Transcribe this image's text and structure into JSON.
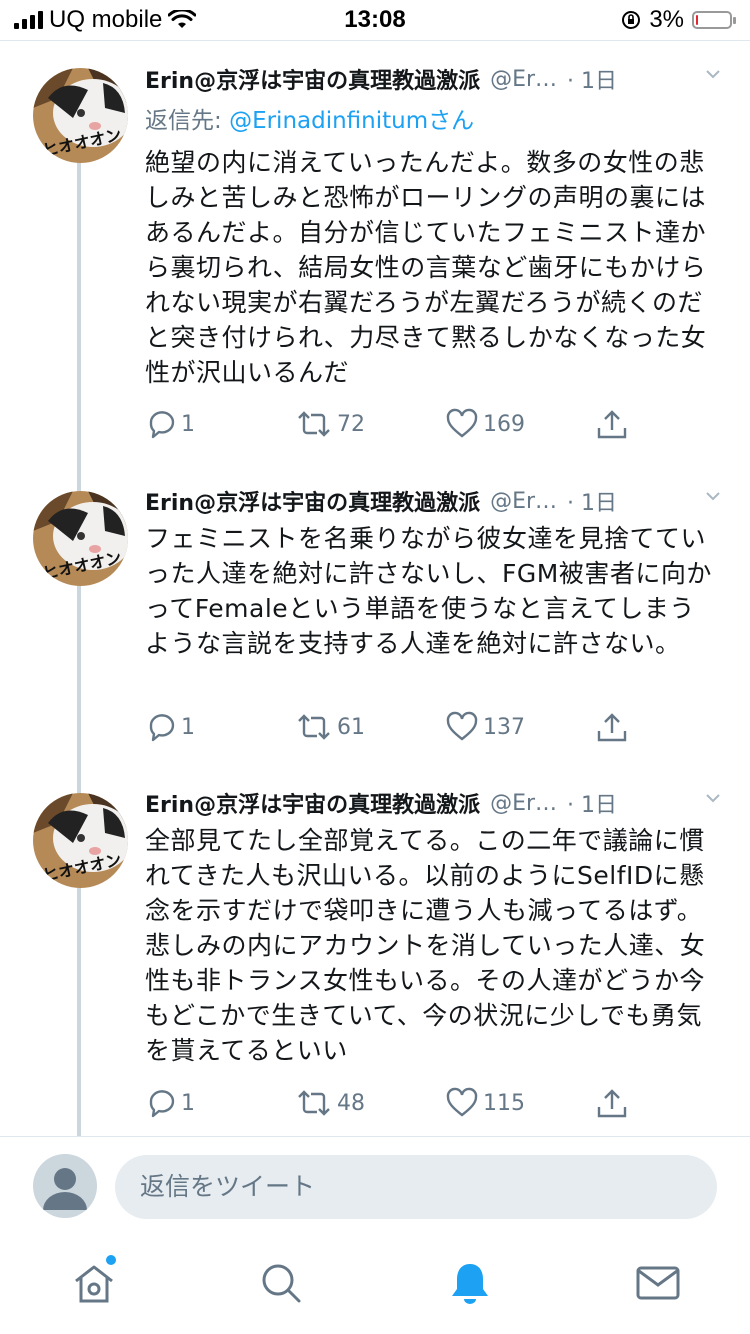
{
  "status_bar": {
    "carrier": "UQ mobile",
    "time": "13:08",
    "battery_percent_text": "3%",
    "battery_level": 0.03
  },
  "tweets": [
    {
      "author_name": "Erin@京浮は宇宙の真理教過激派",
      "handle": "@Er…",
      "time": "· 1日",
      "reply_to_prefix": "返信先: ",
      "reply_to_handle": "@Erinadinfinitum",
      "reply_to_suffix": "さん",
      "text": "絶望の内に消えていったんだよ。数多の女性の悲しみと苦しみと恐怖がローリングの声明の裏にはあるんだよ。自分が信じていたフェミニスト達から裏切られ、結局女性の言葉など歯牙にもかけられない現実が右翼だろうが左翼だろうが続くのだと突き付けられ、力尽きて黙るしかなくなった女性が沢山いるんだ",
      "replies": "1",
      "retweets": "72",
      "likes": "169"
    },
    {
      "author_name": "Erin@京浮は宇宙の真理教過激派",
      "handle": "@Er…",
      "time": "· 1日",
      "text": "フェミニストを名乗りながら彼女達を見捨てていった人達を絶対に許さないし、FGM被害者に向かってFemaleという単語を使うなと言えてしまうような言説を支持する人達を絶対に許さない。",
      "replies": "1",
      "retweets": "61",
      "likes": "137"
    },
    {
      "author_name": "Erin@京浮は宇宙の真理教過激派",
      "handle": "@Er…",
      "time": "· 1日",
      "text": "全部見てたし全部覚えてる。この二年で議論に慣れてきた人も沢山いる。以前のようにSelfIDに懸念を示すだけで袋叩きに遭う人も減ってるはず。悲しみの内にアカウントを消していった人達、女性も非トランス女性もいる。その人達がどうか今もどこかで生きていて、今の状況に少しでも勇気を貰えてるといい",
      "replies": "1",
      "retweets": "48",
      "likes": "115"
    }
  ],
  "composer": {
    "placeholder": "返信をツイート"
  },
  "icons": {
    "reply": "reply-icon",
    "retweet": "retweet-icon",
    "like": "heart-icon",
    "share": "share-icon",
    "home": "home-icon",
    "search": "search-icon",
    "notifications": "bell-icon",
    "messages": "mail-icon"
  },
  "colors": {
    "accent": "#1da1f2",
    "text": "#14171a",
    "secondary": "#657786",
    "thread_line": "#ccd6dd",
    "composer_bg": "#e6ecf0",
    "battery_low": "#e0282e"
  }
}
